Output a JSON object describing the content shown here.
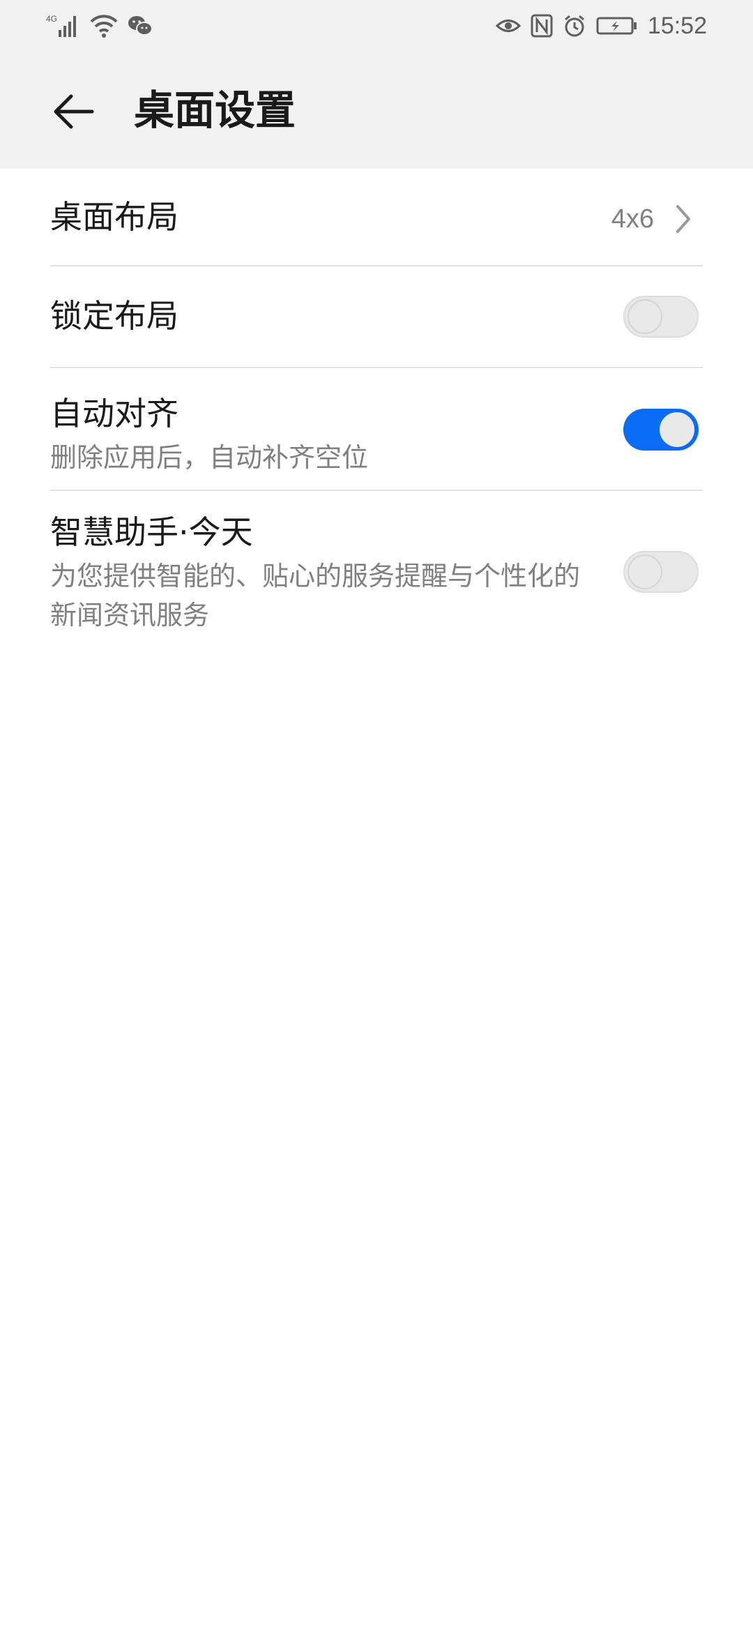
{
  "status_bar": {
    "network_label": "4G",
    "time": "15:52"
  },
  "header": {
    "title": "桌面设置"
  },
  "settings": {
    "desktop_layout": {
      "title": "桌面布局",
      "value": "4x6"
    },
    "lock_layout": {
      "title": "锁定布局",
      "enabled": false
    },
    "auto_align": {
      "title": "自动对齐",
      "subtitle": "删除应用后，自动补齐空位",
      "enabled": true
    },
    "smart_assistant": {
      "title": "智慧助手·今天",
      "subtitle": "为您提供智能的、贴心的服务提醒与个性化的新闻资讯服务",
      "enabled": false
    }
  },
  "colors": {
    "accent": "#0a6cf5",
    "header_bg": "#f1f1f1",
    "divider": "#e2e2e2"
  },
  "icons": {
    "back": "arrow-left-icon",
    "chevron": "chevron-right-icon",
    "signal": "cellular-signal-icon",
    "wifi": "wifi-icon",
    "wechat": "wechat-icon",
    "eye": "eye-comfort-icon",
    "nfc": "nfc-icon",
    "alarm": "alarm-icon",
    "battery": "battery-charging-icon"
  }
}
